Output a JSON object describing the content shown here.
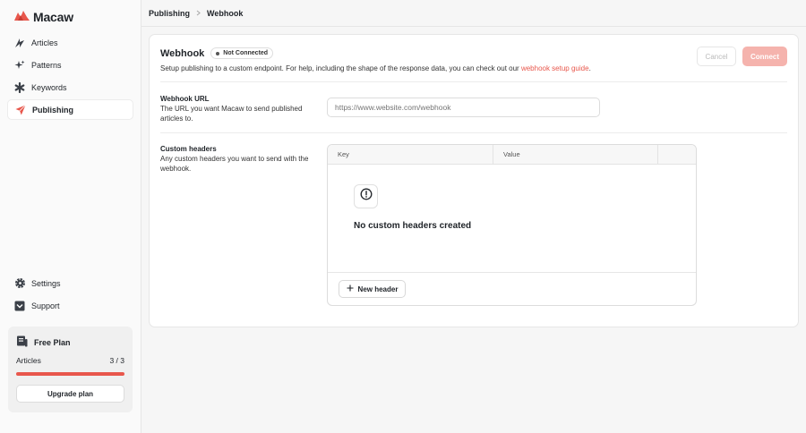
{
  "app": {
    "name": "Macaw",
    "brand_color": "#e8574c"
  },
  "sidebar": {
    "items": [
      {
        "label": "Articles",
        "icon": "bolt-icon"
      },
      {
        "label": "Patterns",
        "icon": "sparkle-icon"
      },
      {
        "label": "Keywords",
        "icon": "asterisk-icon"
      },
      {
        "label": "Publishing",
        "icon": "send-icon",
        "active": true
      }
    ],
    "bottom_items": [
      {
        "label": "Settings",
        "icon": "gear-icon"
      },
      {
        "label": "Support",
        "icon": "support-icon"
      }
    ],
    "plan": {
      "title": "Free Plan",
      "usage_label": "Articles",
      "usage_value": "3 / 3",
      "usage_fraction": 1.0,
      "upgrade_label": "Upgrade plan"
    }
  },
  "breadcrumb": {
    "parent": "Publishing",
    "current": "Webhook"
  },
  "main": {
    "title": "Webhook",
    "status_badge": "Not Connected",
    "subtitle_prefix": "Setup publishing to a custom endpoint. For help, including the shape of the response data, you can check out our ",
    "subtitle_link": "webhook setup guide",
    "subtitle_suffix": ".",
    "cancel_label": "Cancel",
    "connect_label": "Connect",
    "url_field": {
      "label": "Webhook URL",
      "description": "The URL you want Macaw to send published articles to.",
      "placeholder": "https://www.website.com/webhook"
    },
    "headers_field": {
      "label": "Custom headers",
      "description": "Any custom headers you want to send with the webhook.",
      "columns": [
        "Key",
        "Value",
        ""
      ],
      "empty_text": "No custom headers created",
      "new_button_label": "New header"
    }
  }
}
